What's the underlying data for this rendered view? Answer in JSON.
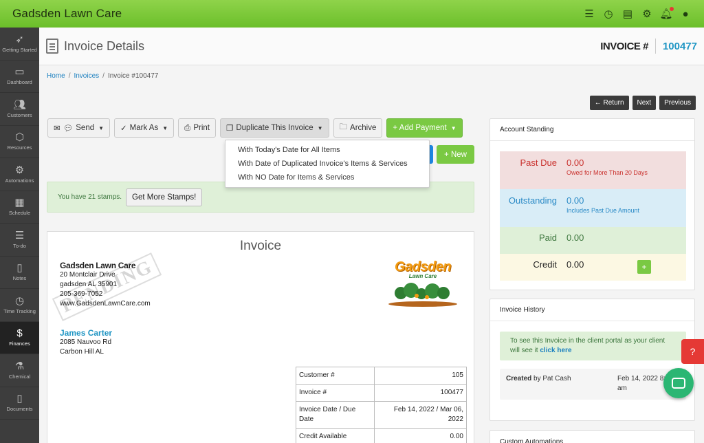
{
  "app": {
    "title": "Gadsden Lawn Care"
  },
  "top_icons": [
    "list-check-icon",
    "clock-icon",
    "chat-icon",
    "gear-icon",
    "bell-icon",
    "user-icon"
  ],
  "sidebar": {
    "items": [
      {
        "label": "Getting Started",
        "icon": "rocket-icon"
      },
      {
        "label": "Dashboard",
        "icon": "monitor-icon"
      },
      {
        "label": "Customers",
        "icon": "users-icon"
      },
      {
        "label": "Resources",
        "icon": "box-icon"
      },
      {
        "label": "Automations",
        "icon": "gears-icon"
      },
      {
        "label": "Schedule",
        "icon": "calendar-icon"
      },
      {
        "label": "To-do",
        "icon": "todo-icon"
      },
      {
        "label": "Notes",
        "icon": "clipboard-icon"
      },
      {
        "label": "Time Tracking",
        "icon": "clock-icon"
      },
      {
        "label": "Finances",
        "icon": "dollar-icon"
      },
      {
        "label": "Chemical",
        "icon": "flask-icon"
      },
      {
        "label": "Documents",
        "icon": "document-icon"
      }
    ]
  },
  "header": {
    "title": "Invoice Details",
    "invoice_label": "INVOICE #",
    "invoice_number": "100477"
  },
  "breadcrumb": {
    "home": "Home",
    "invoices": "Invoices",
    "current": "Invoice #100477"
  },
  "nav": {
    "return": "← Return",
    "next": "Next",
    "previous": "Previous"
  },
  "toolbar": {
    "send": "Send",
    "mark_as": "Mark As",
    "print": "Print",
    "duplicate": "Duplicate This Invoice",
    "archive": "Archive",
    "add_payment": "+ Add Payment",
    "new": "+ New"
  },
  "duplicate_menu": [
    "With Today's Date for All Items",
    "With Date of Duplicated Invoice's Items & Services",
    "With NO Date for Items & Services"
  ],
  "stamps": {
    "text": "You have 21 stamps.",
    "button": "Get More Stamps!"
  },
  "invoice": {
    "title": "Invoice",
    "stamp": "PENDING",
    "company": {
      "name": "Gadsden Lawn Care",
      "address1": "20 Montclair Drive",
      "address2": "gadsden AL 35901",
      "phone": "205-369-7052",
      "web": "www.GadsdenLawnCare.com"
    },
    "logo": {
      "line1": "Gadsden",
      "line2": "Lawn Care"
    },
    "client": {
      "name": "James Carter",
      "address1": "2085 Nauvoo Rd",
      "address2": "Carbon Hill AL"
    },
    "info_rows": [
      {
        "label": "Customer #",
        "value": "105"
      },
      {
        "label": "Invoice #",
        "value": "100477"
      },
      {
        "label": "Invoice Date / Due Date",
        "value": "Feb 14, 2022 / Mar 06, 2022"
      },
      {
        "label": "Credit Available",
        "value": "0.00"
      }
    ]
  },
  "account_standing": {
    "title": "Account Standing",
    "rows": [
      {
        "label": "Past Due",
        "value": "0.00",
        "sub": "Owed for More Than 20 Days",
        "color": "#c9302c",
        "bg": "#f2dede"
      },
      {
        "label": "Outstanding",
        "value": "0.00",
        "sub": "Includes Past Due Amount",
        "color": "#2a8ac6",
        "bg": "#d9edf7"
      },
      {
        "label": "Paid",
        "value": "0.00",
        "sub": "",
        "color": "#3c763d",
        "bg": "#dff0d8"
      },
      {
        "label": "Credit",
        "value": "0.00",
        "sub": "",
        "color": "#222222",
        "bg": "#fcf8e3"
      }
    ],
    "add_credit": "+"
  },
  "invoice_history": {
    "title": "Invoice History",
    "note": "To see this Invoice in the client portal as your client will see it",
    "note_link": "click here",
    "created_label": "Created",
    "created_by": "by Pat Cash",
    "created_date": "Feb 14, 2022 8:",
    "created_time": "am"
  },
  "custom_automations": {
    "title": "Custom Automations"
  }
}
